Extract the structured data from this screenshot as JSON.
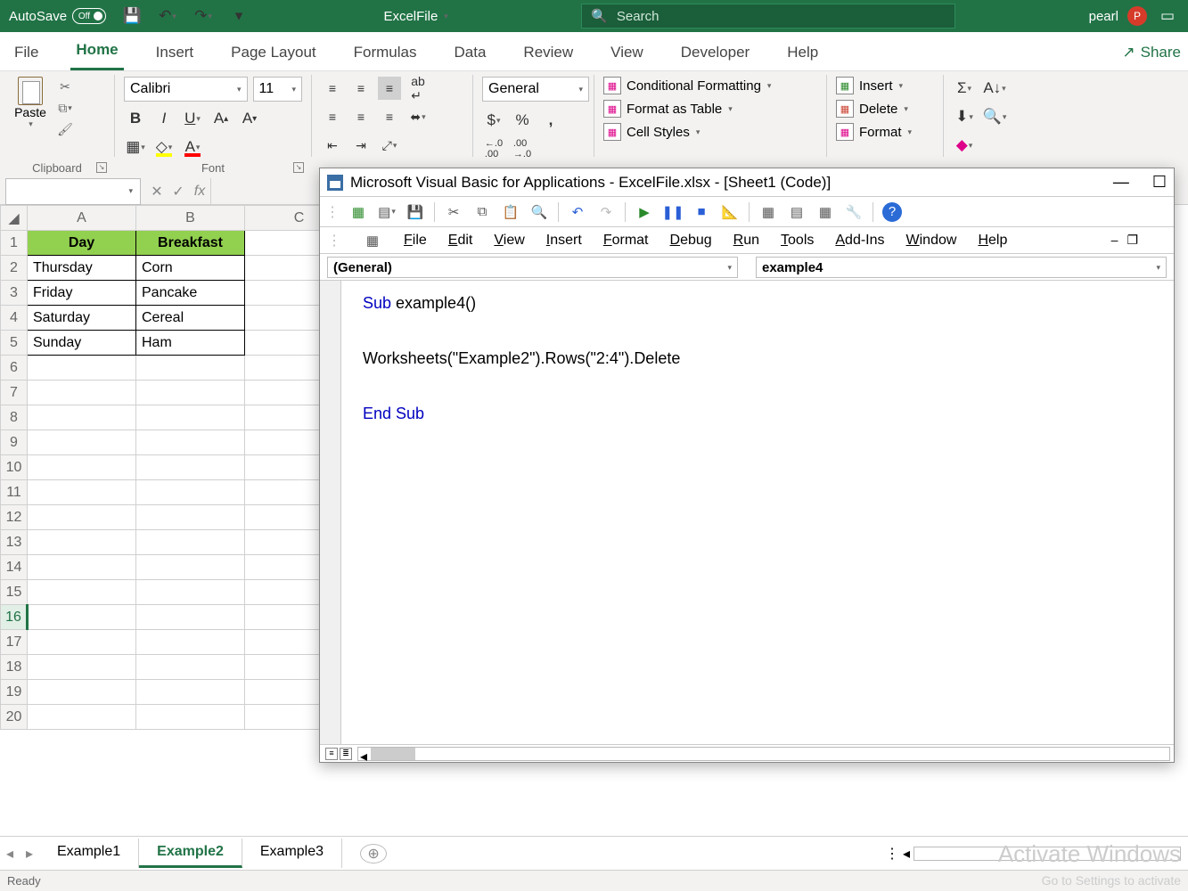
{
  "titlebar": {
    "autosave_label": "AutoSave",
    "autosave_state": "Off",
    "filename": "ExcelFile",
    "search_placeholder": "Search",
    "username": "pearl",
    "user_initial": "P"
  },
  "tabs": {
    "items": [
      "File",
      "Home",
      "Insert",
      "Page Layout",
      "Formulas",
      "Data",
      "Review",
      "View",
      "Developer",
      "Help"
    ],
    "active": "Home",
    "share": "Share"
  },
  "ribbon": {
    "clipboard": {
      "label": "Clipboard",
      "paste": "Paste"
    },
    "font": {
      "label": "Font",
      "name": "Calibri",
      "size": "11"
    },
    "number": {
      "format": "General"
    },
    "styles": {
      "cond": "Conditional Formatting",
      "table": "Format as Table",
      "cell": "Cell Styles"
    },
    "cells": {
      "insert": "Insert",
      "delete": "Delete",
      "format": "Format"
    }
  },
  "columns": [
    "A",
    "B",
    "C"
  ],
  "rows": [
    1,
    2,
    3,
    4,
    5,
    6,
    7,
    8,
    9,
    10,
    11,
    12,
    13,
    14,
    15,
    16,
    17,
    18,
    19,
    20
  ],
  "selected_row": 16,
  "sheet": {
    "headers": [
      "Day",
      "Breakfast"
    ],
    "data": [
      [
        "Thursday",
        "Corn"
      ],
      [
        "Friday",
        "Pancake"
      ],
      [
        "Saturday",
        "Cereal"
      ],
      [
        "Sunday",
        "Ham"
      ]
    ]
  },
  "sheettabs": {
    "items": [
      "Example1",
      "Example2",
      "Example3"
    ],
    "active": "Example2"
  },
  "vbe": {
    "title": "Microsoft Visual Basic for Applications - ExcelFile.xlsx - [Sheet1 (Code)]",
    "menus": [
      "File",
      "Edit",
      "View",
      "Insert",
      "Format",
      "Debug",
      "Run",
      "Tools",
      "Add-Ins",
      "Window",
      "Help"
    ],
    "dd_left": "(General)",
    "dd_right": "example4",
    "code": {
      "l1a": "Sub",
      "l1b": " example4()",
      "l2": "Worksheets(\"Example2\").Rows(\"2:4\").Delete",
      "l3": "End Sub"
    }
  },
  "watermark": "Activate Windows",
  "watermark2": "Go to Settings to activate",
  "status": "Ready"
}
